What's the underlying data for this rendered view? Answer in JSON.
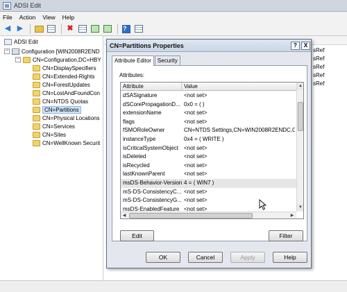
{
  "window": {
    "title": "ADSI Edit"
  },
  "menu": [
    "File",
    "Action",
    "View",
    "Help"
  ],
  "tree": {
    "root": "ADSI Edit",
    "configuration": "Configuration [WIN2008R2END",
    "config_container": "CN=Configuration,DC=HBY",
    "children": [
      "CN=DisplaySpecifiers",
      "CN=Extended-Rights",
      "CN=ForestUpdates",
      "CN=LostAndFoundCon",
      "CN=NTDS Quotas",
      "CN=Partitions",
      "CN=Physical Locations",
      "CN=Services",
      "CN=Sites",
      "CN=WellKnown Securit"
    ],
    "selected": "CN=Partitions"
  },
  "list_values": [
    "sRef",
    "sRef",
    "sRef",
    "sRef",
    "sRef"
  ],
  "dialog": {
    "title": "CN=Partitions Properties",
    "help_button": "?",
    "close_button": "X",
    "tabs": [
      "Attribute Editor",
      "Security"
    ],
    "attributes_label": "Attributes:",
    "columns": [
      "Attribute",
      "Value"
    ],
    "rows": [
      {
        "attribute": "dSASignature",
        "value": "<not set>"
      },
      {
        "attribute": "dSCorePropagationD...",
        "value": "0x0 = ( )"
      },
      {
        "attribute": "extensionName",
        "value": "<not set>"
      },
      {
        "attribute": "flags",
        "value": "<not set>"
      },
      {
        "attribute": "fSMORoleOwner",
        "value": "CN=NTDS Settings,CN=WIN2008R2ENDC,C"
      },
      {
        "attribute": "instanceType",
        "value": "0x4 = ( WRITE )"
      },
      {
        "attribute": "isCriticalSystemObject",
        "value": "<not set>"
      },
      {
        "attribute": "isDeleted",
        "value": "<not set>"
      },
      {
        "attribute": "isRecycled",
        "value": "<not set>"
      },
      {
        "attribute": "lastKnownParent",
        "value": "<not set>"
      },
      {
        "attribute": "msDS-Behavior-Version",
        "value": "4 = ( WIN7 )"
      },
      {
        "attribute": "mS-DS-ConsistencyC...",
        "value": "<not set>"
      },
      {
        "attribute": "mS-DS-ConsistencyG...",
        "value": "<not set>"
      },
      {
        "attribute": "msDS-EnabledFeature",
        "value": "<not set>"
      }
    ],
    "selected_row": "msDS-Behavior-Version",
    "edit_button": "Edit",
    "filter_button": "Filter",
    "ok_button": "OK",
    "cancel_button": "Cancel",
    "apply_button": "Apply",
    "help_button_bottom": "Help"
  }
}
